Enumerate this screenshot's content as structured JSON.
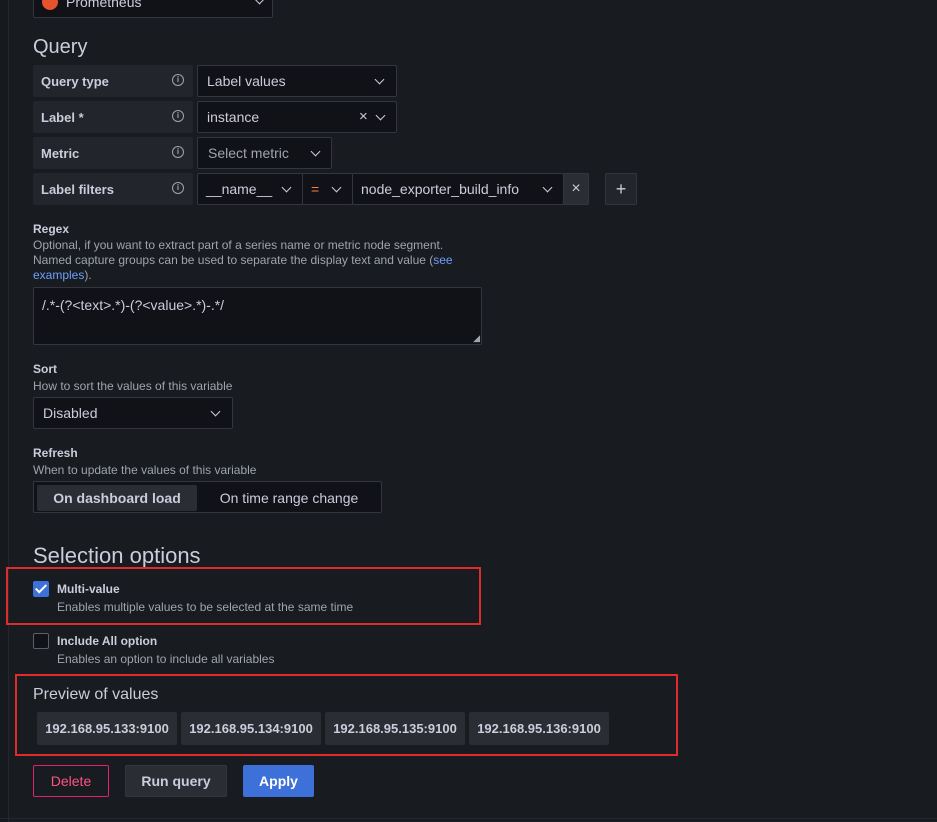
{
  "datasource": {
    "name": "Prometheus"
  },
  "query": {
    "heading": "Query",
    "query_type": {
      "label": "Query type",
      "value": "Label values"
    },
    "label": {
      "label": "Label *",
      "value": "instance"
    },
    "metric": {
      "label": "Metric",
      "placeholder": "Select metric"
    },
    "label_filters": {
      "label": "Label filters",
      "key": "__name__",
      "operator": "=",
      "value": "node_exporter_build_info"
    }
  },
  "regex": {
    "title": "Regex",
    "desc_line1": "Optional, if you want to extract part of a series name or metric node segment.",
    "desc_line2_pre": "Named capture groups can be used to separate the display text and value (",
    "desc_link": "see examples",
    "desc_post": ").",
    "value": "/.*-(?<text>.*)-(?<value>.*)-.*/"
  },
  "sort": {
    "title": "Sort",
    "desc": "How to sort the values of this variable",
    "value": "Disabled"
  },
  "refresh": {
    "title": "Refresh",
    "desc": "When to update the values of this variable",
    "options": [
      "On dashboard load",
      "On time range change"
    ]
  },
  "selection": {
    "heading": "Selection options",
    "multi_value": {
      "title": "Multi-value",
      "desc": "Enables multiple values to be selected at the same time",
      "checked": true
    },
    "include_all": {
      "title": "Include All option",
      "desc": "Enables an option to include all variables",
      "checked": false
    }
  },
  "preview": {
    "heading": "Preview of values",
    "values": [
      "192.168.95.133:9100",
      "192.168.95.134:9100",
      "192.168.95.135:9100",
      "192.168.95.136:9100"
    ]
  },
  "actions": {
    "delete": "Delete",
    "run_query": "Run query",
    "apply": "Apply"
  },
  "colors": {
    "accent": "#3d71d9",
    "danger": "#e0226e",
    "highlight": "#e02b2b"
  }
}
